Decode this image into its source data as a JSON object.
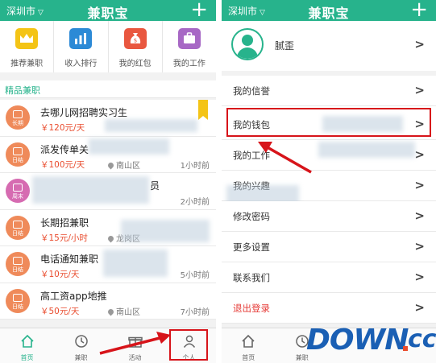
{
  "left": {
    "topbar": {
      "city": "深圳市",
      "title": "兼职宝"
    },
    "categories": [
      {
        "label": "推荐兼职",
        "icon": "crown-icon"
      },
      {
        "label": "收入排行",
        "icon": "bar-chart-icon"
      },
      {
        "label": "我的红包",
        "icon": "money-bag-icon"
      },
      {
        "label": "我的工作",
        "icon": "briefcase-icon"
      }
    ],
    "section_title": "精品兼职",
    "jobs": [
      {
        "badge": "长期",
        "title": "去哪儿网招聘实习生",
        "price": "￥120元/天",
        "location": "",
        "time": ""
      },
      {
        "badge": "日结",
        "title": "派发传单关",
        "price": "￥100元/天",
        "location": "南山区",
        "time": "1小时前"
      },
      {
        "badge": "周末",
        "title": "员",
        "price": "",
        "location": "",
        "time": "2小时前"
      },
      {
        "badge": "日结",
        "title": "长期招兼职",
        "price": "￥15元/小时",
        "location": "龙岗区",
        "time": ""
      },
      {
        "badge": "日结",
        "title": "电话通知兼职",
        "price": "￥10元/天",
        "location": "",
        "time": "5小时前"
      },
      {
        "badge": "日结",
        "title": "高工资app地推",
        "price": "￥50元/天",
        "location": "南山区",
        "time": "7小时前"
      }
    ],
    "tabs": [
      {
        "label": "首页"
      },
      {
        "label": "兼职"
      },
      {
        "label": "活动"
      },
      {
        "label": "个人"
      }
    ]
  },
  "right": {
    "topbar": {
      "city": "深圳市",
      "title": "兼职宝"
    },
    "profile": {
      "name": "腻歪"
    },
    "menu": [
      {
        "label": "我的信誉"
      },
      {
        "label": "我的钱包"
      },
      {
        "label": "我的工作"
      },
      {
        "label": "我的兴趣"
      },
      {
        "label": "修改密码"
      },
      {
        "label": "更多设置"
      },
      {
        "label": "联系我们"
      },
      {
        "label": "退出登录"
      }
    ],
    "tabs": [
      {
        "label": "首页"
      },
      {
        "label": "兼职"
      }
    ]
  },
  "watermark": {
    "main": "DOWN",
    "suffix": "cc"
  },
  "colors": {
    "brand": "#27b38c",
    "highlight": "#d7141a",
    "price": "#e94c2e"
  }
}
